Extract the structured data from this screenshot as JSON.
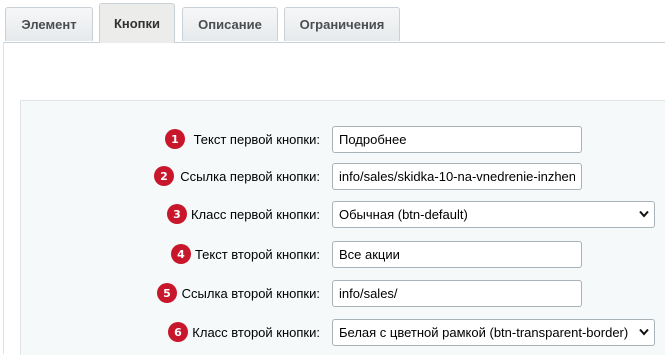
{
  "tabs": [
    {
      "label": "Элемент",
      "active": false
    },
    {
      "label": "Кнопки",
      "active": true
    },
    {
      "label": "Описание",
      "active": false
    },
    {
      "label": "Ограничения",
      "active": false
    }
  ],
  "form": {
    "rows": [
      {
        "num": "1",
        "label": "Текст первой кнопки:",
        "value": "Подробнее",
        "type": "text"
      },
      {
        "num": "2",
        "label": "Ссылка первой кнопки:",
        "value": "info/sales/skidka-10-na-vnedrenie-inzhen",
        "type": "text"
      },
      {
        "num": "3",
        "label": "Класс первой кнопки:",
        "value": "Обычная (btn-default)",
        "type": "select"
      },
      {
        "num": "4",
        "label": "Текст второй кнопки:",
        "value": "Все акции",
        "type": "text"
      },
      {
        "num": "5",
        "label": "Ссылка второй кнопки:",
        "value": "info/sales/",
        "type": "text"
      },
      {
        "num": "6",
        "label": "Класс второй кнопки:",
        "value": "Белая с цветной рамкой (btn-transparent-border)",
        "type": "select"
      }
    ]
  },
  "colors": {
    "badge": "#c8172b",
    "active_tab": "#ececea",
    "panel": "#f5f9f9"
  },
  "icons": {
    "select_arrow": "chevron-down-icon"
  }
}
